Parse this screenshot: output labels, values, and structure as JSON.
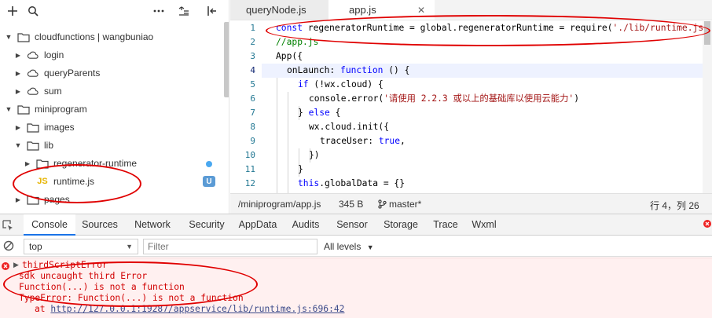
{
  "explorer": {
    "tree": [
      {
        "label": "cloudfunctions | wangbuniao",
        "arrow": "down",
        "icon": "cloud-folder-icon",
        "depth": 0
      },
      {
        "label": "login",
        "arrow": "right",
        "icon": "cloud-icon",
        "depth": 1
      },
      {
        "label": "queryParents",
        "arrow": "right",
        "icon": "cloud-icon",
        "depth": 1
      },
      {
        "label": "sum",
        "arrow": "right",
        "icon": "cloud-icon",
        "depth": 1
      },
      {
        "label": "miniprogram",
        "arrow": "down",
        "icon": "folder-icon",
        "depth": 0
      },
      {
        "label": "images",
        "arrow": "right",
        "icon": "folder-icon",
        "depth": 1
      },
      {
        "label": "lib",
        "arrow": "down",
        "icon": "folder-icon",
        "depth": 1
      },
      {
        "label": "regenerator-runtime",
        "arrow": "right",
        "icon": "folder-icon",
        "depth": 2,
        "badge": "dot"
      },
      {
        "label": "runtime.js",
        "arrow": "",
        "icon": "js-file-icon",
        "depth": 2,
        "badge": "U"
      },
      {
        "label": "pages",
        "arrow": "right",
        "icon": "folder-icon",
        "depth": 1
      }
    ],
    "js_icon_text": "JS",
    "badge_u": "U"
  },
  "editor": {
    "tabs": [
      {
        "label": "queryNode.js",
        "active": false
      },
      {
        "label": "app.js",
        "active": true
      }
    ],
    "tab_close": "✕",
    "lines": [
      "1",
      "2",
      "3",
      "4",
      "5",
      "6",
      "7",
      "8",
      "9",
      "10",
      "11",
      "12"
    ],
    "code": {
      "l1_kw": "const",
      "l1_rest": " regeneratorRuntime = global.regeneratorRuntime = require(",
      "l1_str": "'./lib/runtime.js'",
      "l1_end": ")",
      "l2": "//app.js",
      "l3": "App({",
      "l4_a": "onLaunch: ",
      "l4_kw": "function",
      "l4_b": " () {",
      "l5_kw": "if",
      "l5_rest": " (!wx.cloud) {",
      "l6_a": "console.error(",
      "l6_str": "'请使用 2.2.3 或以上的基础库以使用云能力'",
      "l6_b": ")",
      "l7_a": "} ",
      "l7_kw": "else",
      "l7_b": " {",
      "l8": "wx.cloud.init({",
      "l9_a": "traceUser: ",
      "l9_kw": "true",
      "l9_b": ",",
      "l10": "})",
      "l11": "}",
      "l12_kw": "this",
      "l12_rest": ".globalData = {}"
    },
    "status": {
      "path": "/miniprogram/app.js",
      "size": "345 B",
      "branch": "master*",
      "position": "行 4，列 26"
    }
  },
  "devtools": {
    "tabs": [
      "Console",
      "Sources",
      "Network",
      "Security",
      "AppData",
      "Audits",
      "Sensor",
      "Storage",
      "Trace",
      "Wxml"
    ],
    "active_tab": "Console",
    "context": "top",
    "filter_placeholder": "Filter",
    "levels": "All levels",
    "console": {
      "error_title": "thirdScriptError",
      "line1": "sdk uncaught third Error",
      "line2": "Function(...) is not a function",
      "line3": "TypeError: Function(...) is not a function",
      "line4_prefix": "at ",
      "line4_link": "http://127.0.0.1:19287/appservice/lib/runtime.js:696:42"
    }
  },
  "colors": {
    "annotation": "#e00000",
    "error_text": "#d10000",
    "keyword": "#0000ff",
    "string": "#a31515",
    "comment": "#008000",
    "active_tab_underline": "#1a73e8"
  }
}
